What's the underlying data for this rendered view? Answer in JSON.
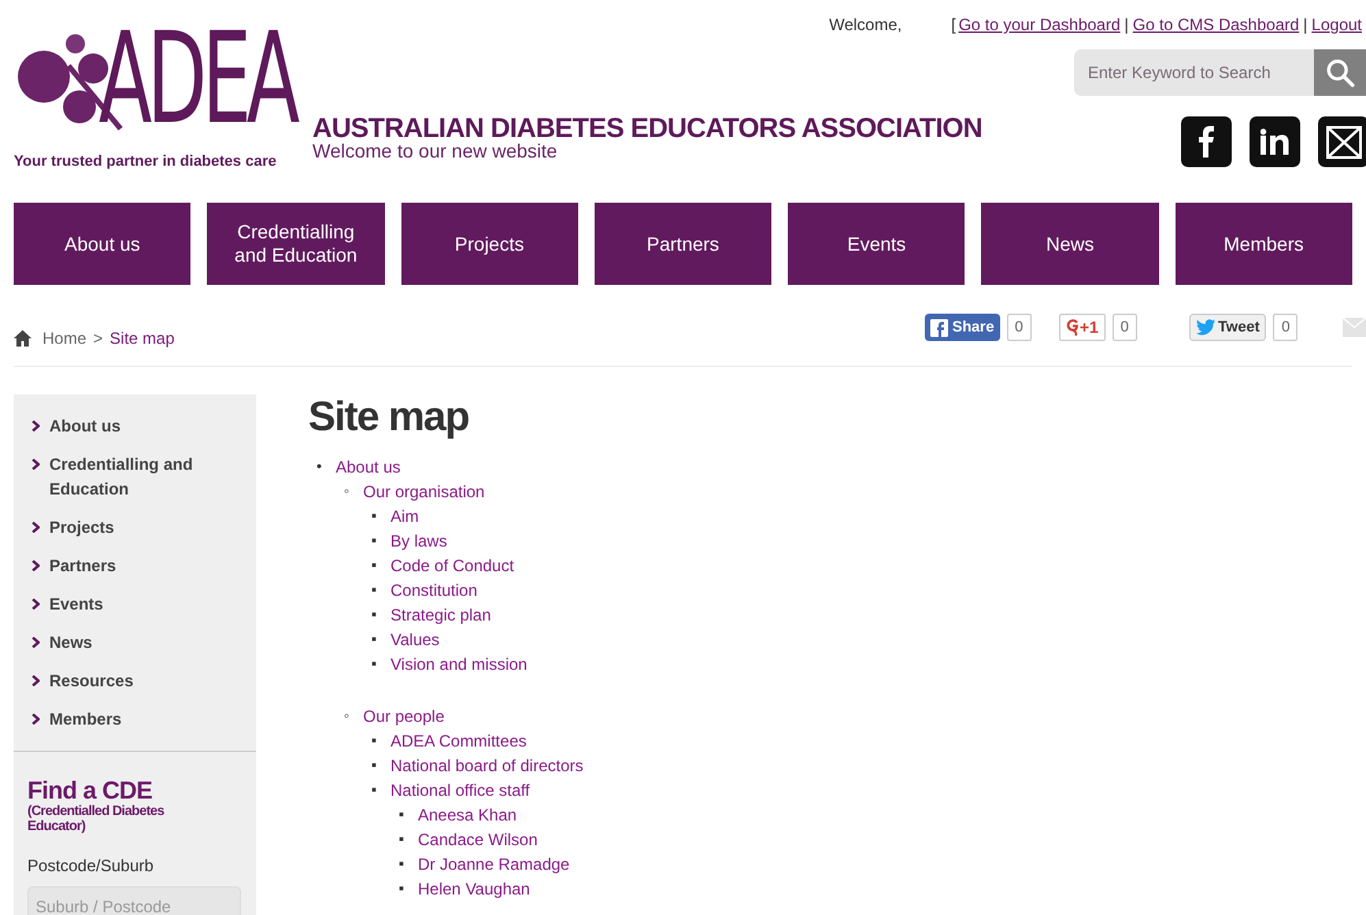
{
  "logo": {
    "text": "ADEA",
    "tagline": "Your trusted partner in diabetes care"
  },
  "header": {
    "title": "AUSTRALIAN DIABETES EDUCATORS ASSOCIATION",
    "subtitle": "Welcome to our new website"
  },
  "user_bar": {
    "welcome": "Welcome,",
    "open": "[",
    "links": [
      "Go to your Dashboard",
      "Go to CMS Dashboard",
      "Logout"
    ],
    "separator": "|"
  },
  "search": {
    "placeholder": "Enter Keyword to Search"
  },
  "nav": [
    {
      "label": "About us"
    },
    {
      "label": "Credentialling and Education"
    },
    {
      "label": "Projects"
    },
    {
      "label": "Partners"
    },
    {
      "label": "Events"
    },
    {
      "label": "News"
    },
    {
      "label": "Members"
    }
  ],
  "breadcrumb": {
    "home": "Home",
    "separator": ">",
    "current": "Site map"
  },
  "share": [
    {
      "kind": "facebook",
      "label": "Share",
      "count": "0"
    },
    {
      "kind": "gplus",
      "label": "+1",
      "count": "0"
    },
    {
      "kind": "twitter",
      "label": "Tweet",
      "count": "0"
    },
    {
      "kind": "email"
    }
  ],
  "sidebar": {
    "items": [
      {
        "label": "About us"
      },
      {
        "label": "Credentialling and Education"
      },
      {
        "label": "Projects"
      },
      {
        "label": "Partners"
      },
      {
        "label": "Events"
      },
      {
        "label": "News"
      },
      {
        "label": "Resources"
      },
      {
        "label": "Members"
      }
    ],
    "find": {
      "title": "Find a CDE",
      "subtitle": "(Credentialled Diabetes Educator)",
      "field_label": "Postcode/Suburb",
      "placeholder": "Suburb / Postcode"
    }
  },
  "page_title": "Site map",
  "sitemap_bullets": [
    "•",
    "◦",
    "▪",
    "▪"
  ],
  "sitemap": [
    {
      "label": "About us",
      "children": [
        {
          "label": "Our organisation",
          "children": [
            {
              "label": "Aim"
            },
            {
              "label": "By laws"
            },
            {
              "label": "Code of Conduct"
            },
            {
              "label": "Constitution"
            },
            {
              "label": "Strategic plan"
            },
            {
              "label": "Values"
            },
            {
              "label": "Vision and mission"
            }
          ]
        },
        {
          "label": "Our people",
          "children": [
            {
              "label": "ADEA Committees"
            },
            {
              "label": "National board of directors"
            },
            {
              "label": "National office staff",
              "children": [
                {
                  "label": "Aneesa Khan"
                },
                {
                  "label": "Candace Wilson"
                },
                {
                  "label": "Dr Joanne Ramadge"
                },
                {
                  "label": "Helen Vaughan"
                }
              ]
            }
          ]
        }
      ]
    }
  ]
}
